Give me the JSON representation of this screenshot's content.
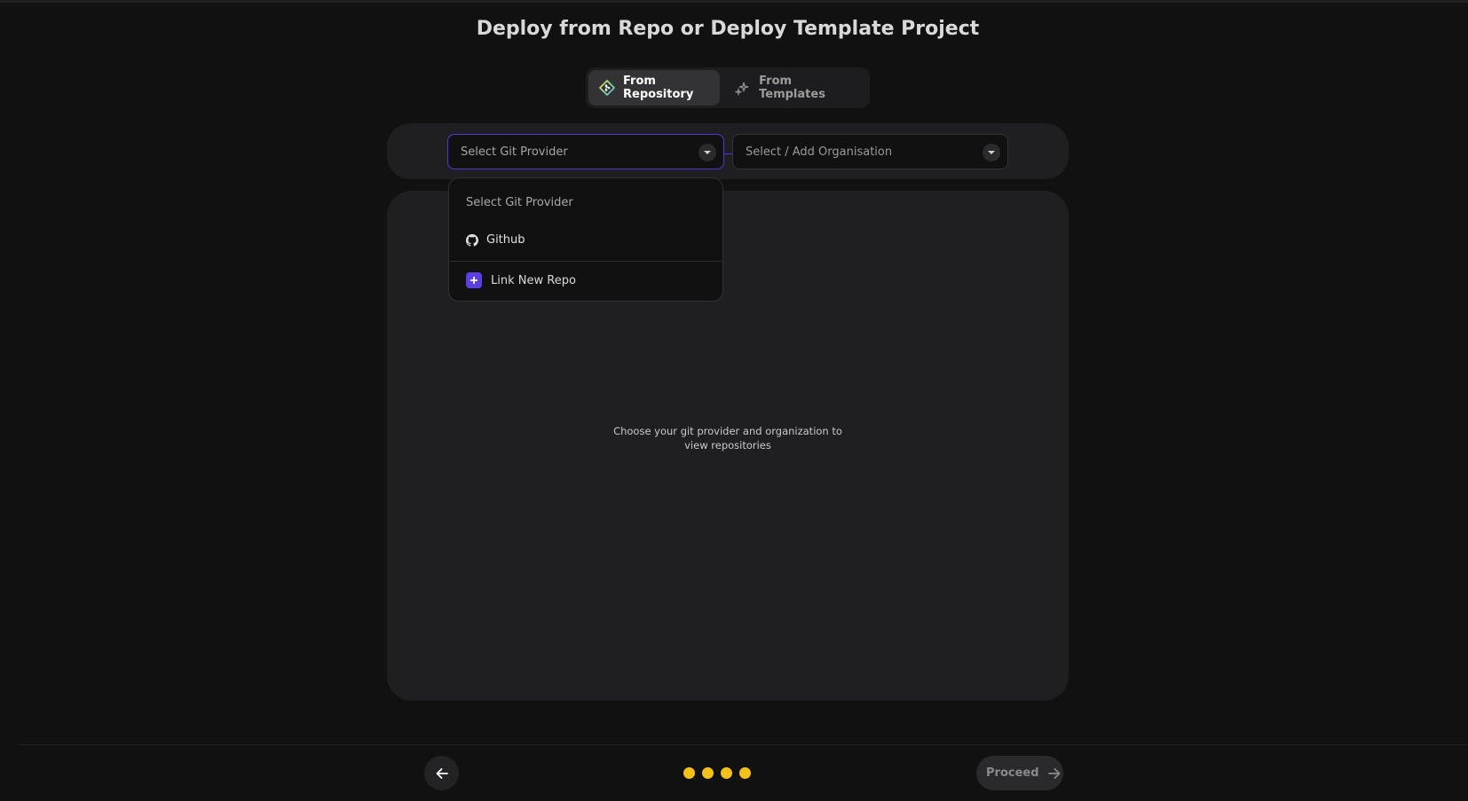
{
  "page_title": "Deploy from Repo or Deploy Template Project",
  "tabs": [
    {
      "label": "From Repository",
      "icon": "git-diamond-icon",
      "active": true
    },
    {
      "label": "From Templates",
      "icon": "sparkle-icon",
      "active": false
    }
  ],
  "git_provider_select": {
    "placeholder": "Select Git Provider"
  },
  "organisation_select": {
    "placeholder": "Select / Add Organisation"
  },
  "dropdown": {
    "placeholder": "Select Git Provider",
    "options": [
      {
        "label": "Github",
        "icon": "github-icon"
      }
    ],
    "link_new_repo": "Link New Repo"
  },
  "empty_state": {
    "message": "Choose your git provider and organization to view repositories"
  },
  "footer": {
    "proceed_label": "Proceed",
    "steps_total": 4
  },
  "colors": {
    "accent": "#4f39d6",
    "step_dot": "#f2c21b",
    "background": "#111112",
    "panel": "#1f1f21"
  }
}
